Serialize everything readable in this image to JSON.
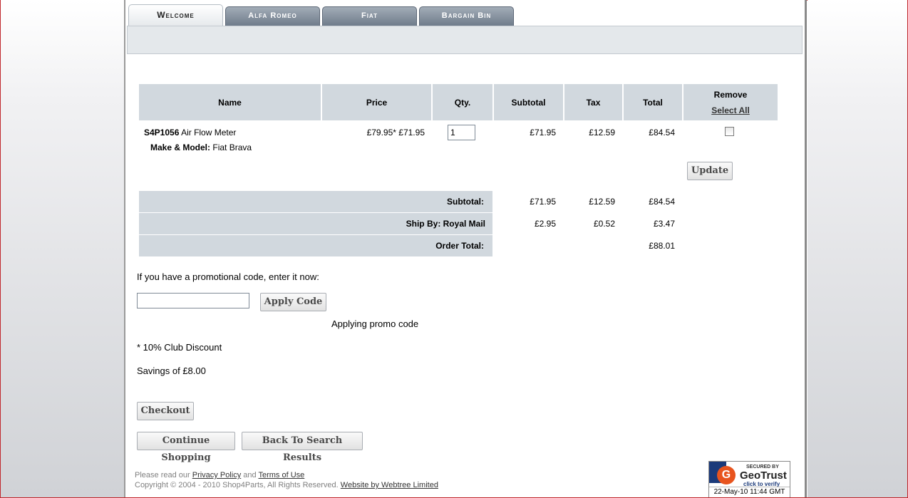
{
  "tabs": [
    "Welcome",
    "Alfa Romeo",
    "Fiat",
    "Bargain Bin"
  ],
  "cart": {
    "headers": {
      "name": "Name",
      "price": "Price",
      "qty": "Qty.",
      "subtotal": "Subtotal",
      "tax": "Tax",
      "total": "Total",
      "remove": "Remove",
      "select_all": "Select All"
    },
    "item": {
      "sku": "S4P1056",
      "name": "Air Flow Meter",
      "make_model_label": "Make & Model:",
      "make_model": "Fiat Brava",
      "price": "£79.95* £71.95",
      "qty": "1",
      "subtotal": "£71.95",
      "tax": "£12.59",
      "total": "£84.54"
    },
    "update_label": "Update"
  },
  "summary": {
    "subtotal": {
      "label": "Subtotal:",
      "subtotal": "£71.95",
      "tax": "£12.59",
      "total": "£84.54"
    },
    "shipping": {
      "label": "Ship By: Royal Mail",
      "subtotal": "£2.95",
      "tax": "£0.52",
      "total": "£3.47"
    },
    "order_total": {
      "label": "Order Total:",
      "total": "£88.01"
    }
  },
  "promo": {
    "prompt": "If you have a promotional code, enter it now:",
    "input_value": "",
    "apply_label": "Apply Code",
    "applying": "Applying promo code"
  },
  "discount_note": "* 10% Club Discount",
  "savings": "Savings of £8.00",
  "buttons": {
    "checkout": "Checkout",
    "continue": "Continue Shopping",
    "back": "Back To Search Results"
  },
  "footer": {
    "line1_prefix": "Please read our",
    "privacy": "Privacy Policy",
    "and": "and",
    "terms": "Terms of Use",
    "copyright": "Copyright © 2004 - 2010 Shop4Parts, All Rights Reserved.",
    "webtree": "Website by Webtree Limited"
  },
  "badge": {
    "secured": "SECURED BY",
    "geotrust": "GeoTrust",
    "click": "click to verify",
    "date": "22-May-10 11:44 GMT"
  },
  "colors": {
    "header_bg": "#d1d8de",
    "tab_bg": "#7a8797",
    "frame": "#c0282d"
  }
}
